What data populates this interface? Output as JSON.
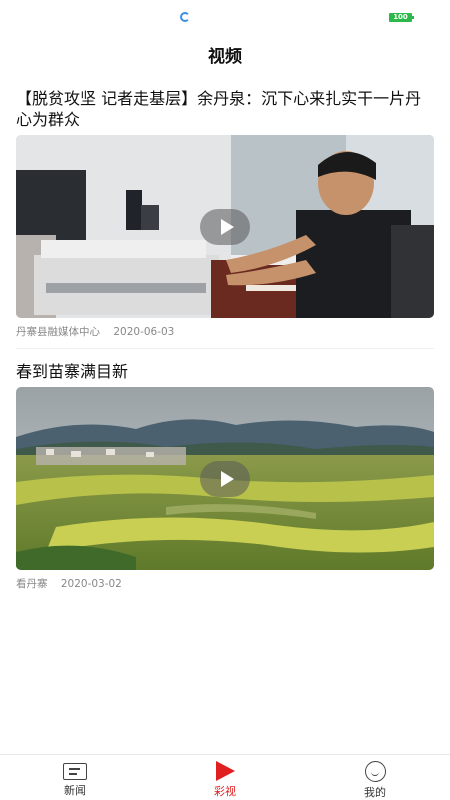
{
  "status_bar": {
    "battery": "100"
  },
  "page": {
    "title": "视频"
  },
  "videos": [
    {
      "title": "【脱贫攻坚 记者走基层】余丹泉：沉下心来扎实干一片丹心为群众",
      "source": "丹寨县融媒体中心",
      "date": "2020-06-03"
    },
    {
      "title": "春到苗寨满目新",
      "source": "看丹寨",
      "date": "2020-03-02"
    }
  ],
  "tabbar": {
    "items": [
      {
        "label": "新闻",
        "icon": "news-icon"
      },
      {
        "label": "彩视",
        "icon": "play-icon"
      },
      {
        "label": "我的",
        "icon": "profile-icon"
      }
    ],
    "active_index": 1
  },
  "colors": {
    "accent": "#e02020",
    "battery": "#2db84b"
  }
}
